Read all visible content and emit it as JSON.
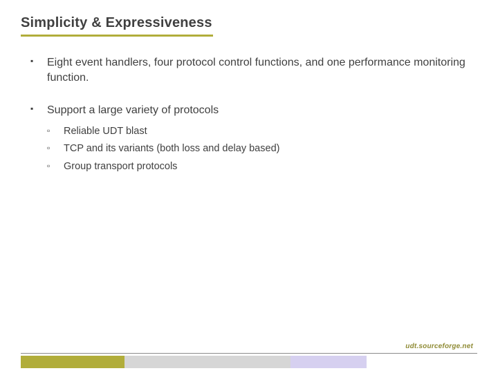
{
  "title": "Simplicity & Expressiveness",
  "bullets": [
    {
      "text": "Eight event handlers, four protocol control functions, and one performance monitoring function."
    },
    {
      "text": "Support a large variety of protocols",
      "children": [
        "Reliable UDT blast",
        "TCP and its variants (both loss and delay based)",
        "Group transport protocols"
      ]
    }
  ],
  "footer_url": "udt.sourceforge.net",
  "footer_bar": [
    {
      "color": "#b1ad3a",
      "style": "width:150px;background:#b1ad3a"
    },
    {
      "color": "#d6d6d6",
      "style": "width:240px;background:#d6d6d6"
    },
    {
      "color": "#d6d0f0",
      "style": "width:110px;background:#d6d0f0"
    }
  ],
  "colors": {
    "accent_olive": "#b1ad3a",
    "text": "#3f3f3f",
    "footer_text": "#8f8b35"
  }
}
